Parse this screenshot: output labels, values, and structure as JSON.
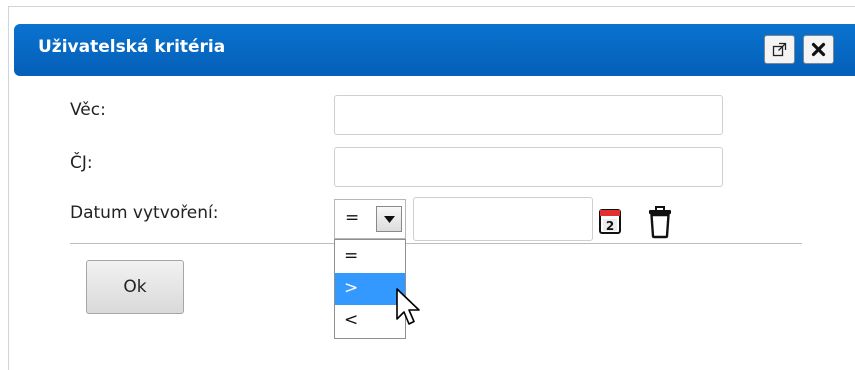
{
  "dialog": {
    "title": "Uživatelská kritéria",
    "accent_color": "#0a6fcc",
    "popout_icon": "popout-icon",
    "close_icon": "close-icon"
  },
  "form": {
    "vec_label": "Věc:",
    "vec_value": "",
    "cj_label": "ČJ:",
    "cj_value": "",
    "datum_label": "Datum vytvoření:",
    "operator_selected": "=",
    "operator_options": [
      "=",
      ">",
      "<"
    ],
    "highlighted_option": ">",
    "date_value": "",
    "calendar_day": "2",
    "ok_label": "Ok"
  }
}
